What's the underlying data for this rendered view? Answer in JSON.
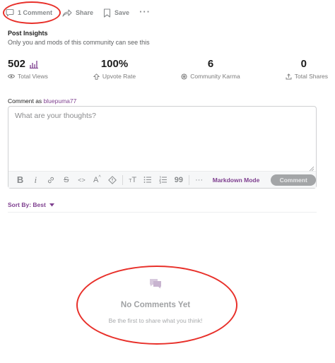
{
  "actions": {
    "comment": "1 Comment",
    "share": "Share",
    "save": "Save",
    "more": "···"
  },
  "insights": {
    "title": "Post Insights",
    "subtitle": "Only you and mods of this community can see this",
    "stats": [
      {
        "value": "502",
        "label": "Total Views",
        "icon": "eye-icon"
      },
      {
        "value": "100%",
        "label": "Upvote Rate",
        "icon": "upvote-icon"
      },
      {
        "value": "6",
        "label": "Community Karma",
        "icon": "karma-icon"
      },
      {
        "value": "0",
        "label": "Total Shares",
        "icon": "share-icon"
      }
    ]
  },
  "comment_box": {
    "prefix": "Comment as",
    "username": "bluepuma77",
    "placeholder": "What are your thoughts?",
    "toolbar": {
      "bold": "B",
      "italic": "i",
      "link": "",
      "strikethrough": "S",
      "code": "<>",
      "superscript": "A",
      "spoiler": "!",
      "heading": "T",
      "bulleted_list": "",
      "numbered_list": "",
      "quote": "99",
      "more": "···"
    },
    "markdown_mode": "Markdown Mode",
    "submit": "Comment"
  },
  "sort": {
    "label": "Sort By: Best"
  },
  "empty_state": {
    "title": "No Comments Yet",
    "subtitle": "Be the first to share what you think!"
  },
  "colors": {
    "accent": "#7e3f8f",
    "annotation": "#e8302a",
    "muted": "#878a8c"
  }
}
